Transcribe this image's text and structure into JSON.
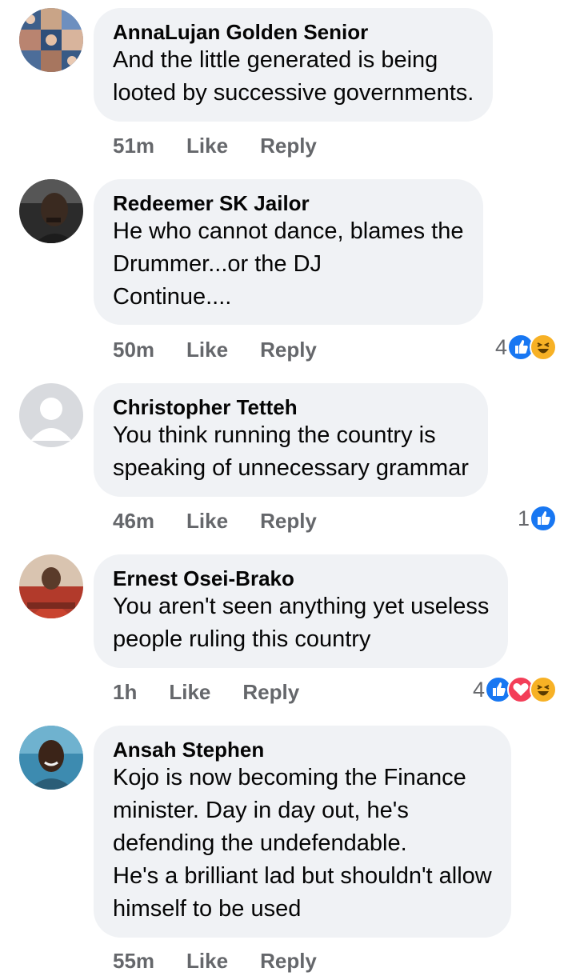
{
  "comments": [
    {
      "author": "AnnaLujan Golden Senior",
      "text": "And the little generated is being\nlooted by successive governments.",
      "time": "51m",
      "like_label": "Like",
      "reply_label": "Reply",
      "avatar_icon": "photo-collage-avatar-icon"
    },
    {
      "author": "Redeemer SK Jailor",
      "text": "He who cannot dance, blames the\nDrummer...or the DJ\nContinue....",
      "time": "50m",
      "like_label": "Like",
      "reply_label": "Reply",
      "reaction_count": "4",
      "reactions": [
        "like-reaction-icon",
        "haha-reaction-icon"
      ],
      "avatar_icon": "person-photo-avatar-icon"
    },
    {
      "author": "Christopher Tetteh",
      "text": "You think running the country is\nspeaking of unnecessary grammar",
      "time": "46m",
      "like_label": "Like",
      "reply_label": "Reply",
      "reaction_count": "1",
      "reactions": [
        "like-reaction-icon"
      ],
      "avatar_icon": "default-user-avatar-icon"
    },
    {
      "author": "Ernest Osei-Brako",
      "text": "You aren't seen anything yet useless\npeople ruling this country",
      "time": "1h",
      "like_label": "Like",
      "reply_label": "Reply",
      "reaction_count": "4",
      "reactions": [
        "like-reaction-icon",
        "love-reaction-icon",
        "haha-reaction-icon"
      ],
      "avatar_icon": "person-photo-avatar-icon"
    },
    {
      "author": "Ansah Stephen",
      "text": "Kojo is now becoming the Finance\nminister. Day in day out, he's\ndefending the undefendable.\nHe's a brilliant lad but shouldn't allow\nhimself to be used",
      "time": "55m",
      "like_label": "Like",
      "reply_label": "Reply",
      "avatar_icon": "person-photo-avatar-icon"
    }
  ],
  "colors": {
    "bubble": "#f0f2f5",
    "meta_text": "#65676b",
    "like_blue": "#1877f2",
    "love_red": "#f33e58",
    "haha_yellow": "#f7b125"
  }
}
